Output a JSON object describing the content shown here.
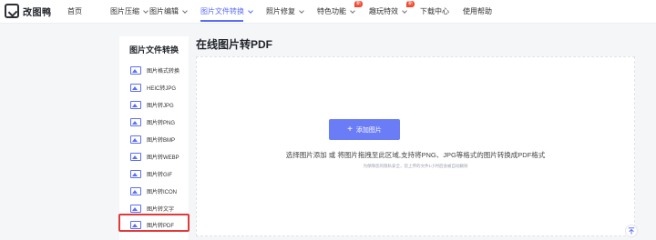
{
  "app": {
    "logo_text": "改图鸭"
  },
  "nav": {
    "items": [
      {
        "label": "首页",
        "dropdown": false,
        "badge": "",
        "active": false
      },
      {
        "label": "图片压缩",
        "dropdown": true,
        "badge": "",
        "active": false
      },
      {
        "label": "图片编辑",
        "dropdown": true,
        "badge": "",
        "active": false
      },
      {
        "label": "图片文件转换",
        "dropdown": true,
        "badge": "",
        "active": true
      },
      {
        "label": "照片修复",
        "dropdown": true,
        "badge": "",
        "active": false
      },
      {
        "label": "特色功能",
        "dropdown": true,
        "badge": "新",
        "active": false
      },
      {
        "label": "趣玩特效",
        "dropdown": true,
        "badge": "新",
        "active": false
      },
      {
        "label": "下载中心",
        "dropdown": false,
        "badge": "",
        "active": false
      },
      {
        "label": "使用帮助",
        "dropdown": false,
        "badge": "",
        "active": false
      }
    ]
  },
  "sidebar": {
    "title": "图片文件转换",
    "items": [
      {
        "label": "图片格式转换",
        "active": false
      },
      {
        "label": "HEIC转JPG",
        "active": false
      },
      {
        "label": "图片转JPG",
        "active": false
      },
      {
        "label": "图片转PNG",
        "active": false
      },
      {
        "label": "图片转BMP",
        "active": false
      },
      {
        "label": "图片转WEBP",
        "active": false
      },
      {
        "label": "图片转GIF",
        "active": false
      },
      {
        "label": "图片转ICON",
        "active": false
      },
      {
        "label": "图片转文字",
        "active": false
      },
      {
        "label": "图片转PDF",
        "active": true
      }
    ]
  },
  "main": {
    "title": "在线图片转PDF",
    "upload_button_label": "添加图片",
    "upload_button_icon": "plus-icon",
    "hint": "选择图片添加 或 将图片拖拽至此区域,支持将PNG、JPG等格式的图片转换成PDF格式",
    "sub_hint": "为保障您的隐私安全，您上传的文件1小时后会被自动删除"
  },
  "colors": {
    "accent": "#5b6ef5",
    "button": "#6b7cf7",
    "badge": "#f5492f",
    "highlight_box": "#e03a3a"
  }
}
